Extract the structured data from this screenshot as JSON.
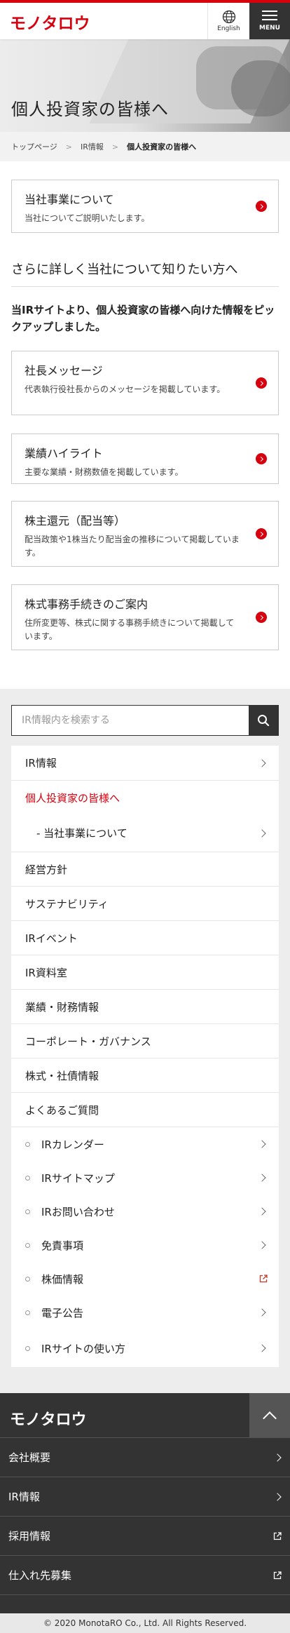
{
  "header": {
    "logo": "モノタロウ",
    "lang_label": "English",
    "menu_label": "MENU"
  },
  "hero": {
    "title": "個人投資家の皆様へ"
  },
  "breadcrumb": {
    "items": [
      "トップページ",
      "IR情報",
      "個人投資家の皆様へ"
    ]
  },
  "about_card": {
    "title": "当社事業について",
    "desc": "当社についてご説明いたします。"
  },
  "section": {
    "title": "さらに詳しく当社について知りたい方へ",
    "lead": "当IRサイトより、個人投資家の皆様へ向けた情報をピックアップしました。"
  },
  "cards": [
    {
      "title": "社長メッセージ",
      "desc": "代表執行役社長からのメッセージを掲載しています。"
    },
    {
      "title": "業績ハイライト",
      "desc": "主要な業績・財務数値を掲載しています。"
    },
    {
      "title": "株主還元（配当等）",
      "desc": "配当政策や1株当たり配当金の推移について掲載しています。"
    },
    {
      "title": "株式事務手続きのご案内",
      "desc": "住所変更等、株式に関する事務手続きについて掲載しています。"
    }
  ],
  "search": {
    "placeholder": "IR情報内を検索する"
  },
  "nav": {
    "ir_top": "IR情報",
    "active": "個人投資家の皆様へ",
    "sub": "- 当社事業について",
    "items": [
      "経営方針",
      "サステナビリティ",
      "IRイベント",
      "IR資料室",
      "業績・財務情報",
      "コーポレート・ガバナンス",
      "株式・社債情報",
      "よくあるご質問"
    ],
    "bullets": [
      "IRカレンダー",
      "IRサイトマップ",
      "IRお問い合わせ",
      "免責事項",
      "株価情報",
      "電子公告",
      "IRサイトの使い方"
    ]
  },
  "footer": {
    "logo": "モノタロウ",
    "links": [
      "会社概要",
      "IR情報",
      "採用情報",
      "仕入れ先募集"
    ],
    "copyright": "© 2020 MonotaRO Co., Ltd. All Rights Reserved."
  },
  "colors": {
    "accent": "#d7000f",
    "dark": "#333333"
  }
}
